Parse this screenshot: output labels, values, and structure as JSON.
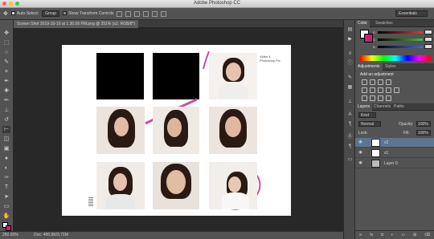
{
  "app": {
    "title": "Adobe Photoshop CC"
  },
  "options": {
    "auto_select_label": "Auto-Select:",
    "auto_select_value": "Group",
    "transform_label": "Show Transform Controls",
    "workspace": "Essentials"
  },
  "document": {
    "tab_title": "Screen Shot 2019-10-15 at 1.30.56 PM.png @ 251% (s2, RGB/8*)",
    "caption_line1": "Video 4",
    "caption_line2": "Photoshop Fix"
  },
  "status": {
    "zoom": "250.93%",
    "doc_info": "Doc: 400.9K/3.71M"
  },
  "color_panel": {
    "tabs": [
      "Color",
      "Swatches"
    ],
    "channels": [
      {
        "label": "R",
        "value": "",
        "color": "#e23a3a"
      },
      {
        "label": "G",
        "value": "",
        "color": "#3ac23a"
      },
      {
        "label": "B",
        "value": "",
        "color": "#3a6ae2"
      }
    ]
  },
  "adjustments_panel": {
    "tabs": [
      "Adjustments",
      "Styles"
    ],
    "heading": "Add an adjustment"
  },
  "layers_panel": {
    "tabs": [
      "Layers",
      "Channels",
      "Paths"
    ],
    "kind": "Kind",
    "blend_mode": "Normal",
    "opacity_label": "Opacity:",
    "opacity_value": "100%",
    "lock_label": "Lock:",
    "fill_label": "Fill:",
    "fill_value": "100%",
    "layers": [
      {
        "name": "s2",
        "selected": true
      },
      {
        "name": "s1",
        "selected": false
      },
      {
        "name": "Layer 0",
        "selected": false
      }
    ]
  },
  "colors": {
    "accent": "#c84fa0",
    "panel_bg": "#535353",
    "selected_layer": "#5e7590"
  }
}
